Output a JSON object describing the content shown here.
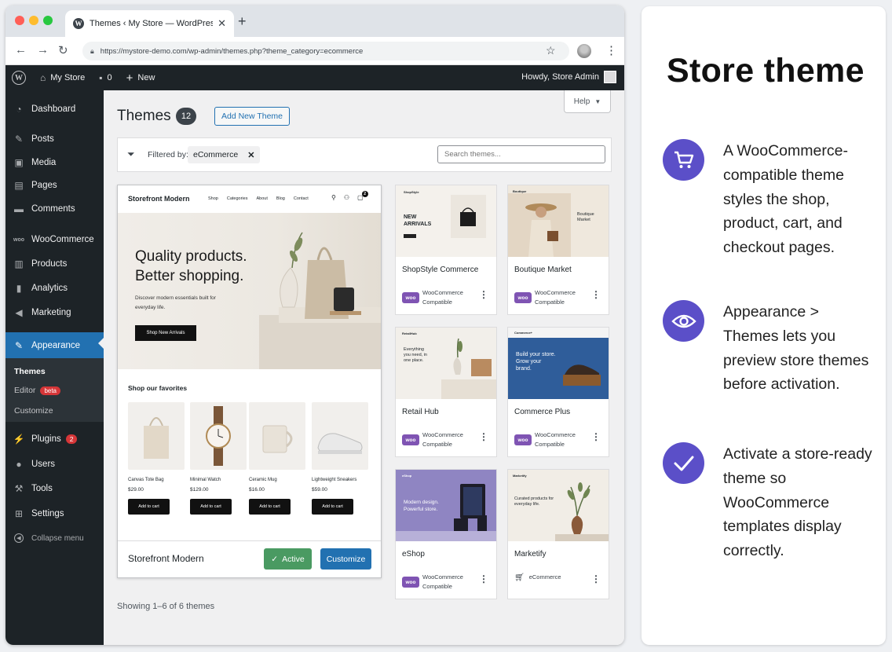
{
  "browser": {
    "tab_title": "Themes ‹ My Store — WordPress",
    "url": "https://mystore-demo.com/wp-admin/themes.php?theme_category=ecommerce",
    "new_tab_symbol": "+"
  },
  "admin_bar": {
    "site_name": "My Store",
    "comments_count": "0",
    "new_label": "New",
    "howdy": "Howdy, Store Admin"
  },
  "sidebar": {
    "items": {
      "dashboard": "Dashboard",
      "posts": "Posts",
      "media": "Media",
      "pages": "Pages",
      "comments": "Comments",
      "woocommerce": "WooCommerce",
      "products": "Products",
      "analytics": "Analytics",
      "marketing": "Marketing",
      "appearance": "Appearance",
      "plugins": "Plugins",
      "users": "Users",
      "tools": "Tools",
      "settings": "Settings",
      "collapse": "Collapse menu"
    },
    "plugins_badge": "2",
    "submenu": {
      "themes": "Themes",
      "editor": "Editor",
      "editor_badge": "beta",
      "customize": "Customize"
    }
  },
  "main": {
    "title": "Themes",
    "count": "12",
    "add_new": "Add New Theme",
    "help": "Help",
    "filtered_by": "Filtered by:",
    "filter_chip": "eCommerce",
    "search_placeholder": "Search themes...",
    "showing": "Showing 1–6 of 6 themes"
  },
  "active_theme": {
    "name": "Storefront Modern",
    "active_label": "Active",
    "customize_label": "Customize",
    "preview": {
      "logo": "Storefront Modern",
      "nav": [
        "Shop",
        "Categories",
        "About",
        "Blog",
        "Contact"
      ],
      "cart_count": "2",
      "hero_line1": "Quality products.",
      "hero_line2": "Better shopping.",
      "hero_sub": "Discover modern essentials built for everyday life.",
      "hero_button": "Shop New Arrivals",
      "favorites_title": "Shop our favorites",
      "products": [
        {
          "name": "Canvas Tote Bag",
          "price": "$29.00",
          "button": "Add to cart"
        },
        {
          "name": "Minimal Watch",
          "price": "$129.00",
          "button": "Add to cart"
        },
        {
          "name": "Ceramic Mug",
          "price": "$16.00",
          "button": "Add to cart"
        },
        {
          "name": "Lightweight Sneakers",
          "price": "$59.00",
          "button": "Add to cart"
        }
      ]
    }
  },
  "themes": [
    {
      "name": "ShopStyle Commerce",
      "badge_line1": "WooCommerce",
      "badge_line2": "Compatible",
      "preview_text": "NEW ARRIVALS",
      "preview_brand": "ShopStyle"
    },
    {
      "name": "Boutique Market",
      "badge_line1": "WooCommerce",
      "badge_line2": "Compatible",
      "preview_text": "Boutique Market",
      "preview_brand": "Boutique"
    },
    {
      "name": "Retail Hub",
      "badge_line1": "WooCommerce",
      "badge_line2": "Compatible",
      "preview_text": "Everything you need, in one place.",
      "preview_brand": "RetailHub"
    },
    {
      "name": "Commerce Plus",
      "badge_line1": "WooCommerce",
      "badge_line2": "Compatible",
      "preview_text": "Build your store. Grow your brand.",
      "preview_brand": "Commerce+"
    },
    {
      "name": "eShop",
      "badge_line1": "WooCommerce",
      "badge_line2": "Compatible",
      "preview_text": "Modern design. Powerful store.",
      "preview_brand": "eShop"
    },
    {
      "name": "Marketify",
      "badge_line1": "eCommerce",
      "badge_line2": "",
      "preview_text": "Curated products for everyday life.",
      "preview_brand": "Marketify"
    }
  ],
  "panel": {
    "title": "Store theme",
    "features": [
      {
        "icon": "cart-icon",
        "text": "A WooCommerce-compatible theme styles the shop, product, cart, and checkout pages."
      },
      {
        "icon": "eye-icon",
        "text": "Appearance > Themes lets you preview store themes before activation."
      },
      {
        "icon": "check-icon",
        "text": "Activate a store-ready theme so WooCommerce templates display correctly."
      }
    ]
  },
  "colors": {
    "wp_dark": "#1d2327",
    "wp_blue": "#2271b1",
    "active_green": "#4a9a62",
    "woo_purple": "#7f54b3",
    "panel_accent": "#5b4fc8"
  }
}
